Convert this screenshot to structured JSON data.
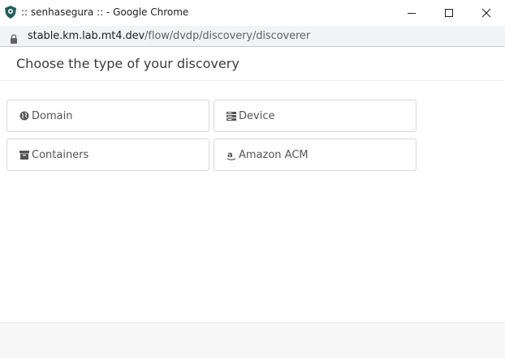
{
  "window": {
    "title": ":: senhasegura :: - Google Chrome",
    "app_icon": "shield-icon"
  },
  "address_bar": {
    "host": "stable.km.lab.mt4.dev",
    "path": "/flow/dvdp/discovery/discoverer"
  },
  "modal": {
    "title": "Choose the type of your discovery",
    "options": [
      {
        "label": "Domain",
        "icon": "globe-icon"
      },
      {
        "label": "Device",
        "icon": "server-icon"
      },
      {
        "label": "Containers",
        "icon": "archive-icon"
      },
      {
        "label": "Amazon ACM",
        "icon": "amazon-icon"
      }
    ]
  },
  "colors": {
    "brand_icon": "#1e5f5a",
    "option_border": "#d9d9d9",
    "text": "#555555"
  }
}
